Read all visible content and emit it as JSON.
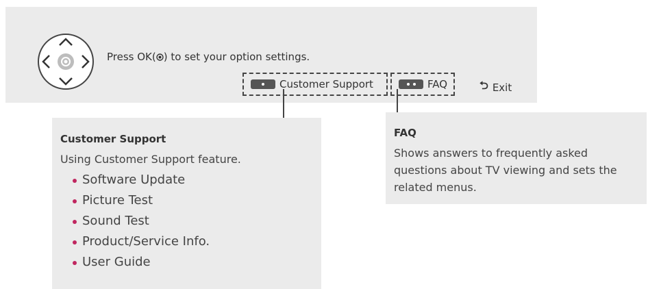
{
  "header": {
    "instruction_before": "Press OK(",
    "instruction_after": ") to set your option settings.",
    "buttons": [
      {
        "label": "Customer Support"
      },
      {
        "label": "FAQ"
      }
    ],
    "exit_label": "Exit"
  },
  "customer_support": {
    "title": "Customer Support",
    "description": "Using Customer Support feature.",
    "items": [
      "Software Update",
      "Picture Test",
      "Sound Test",
      "Product/Service Info.",
      "User Guide"
    ]
  },
  "faq": {
    "title": "FAQ",
    "description": "Shows answers to frequently asked questions about TV viewing and sets the related menus."
  },
  "colors": {
    "bullet": "#c0265f",
    "panel": "#ebebeb",
    "remote_button": "#555555"
  },
  "icons": {
    "dpad": "navigation-dpad-icon",
    "ok": "ok-button-icon",
    "exit": "back-arrow-icon"
  }
}
